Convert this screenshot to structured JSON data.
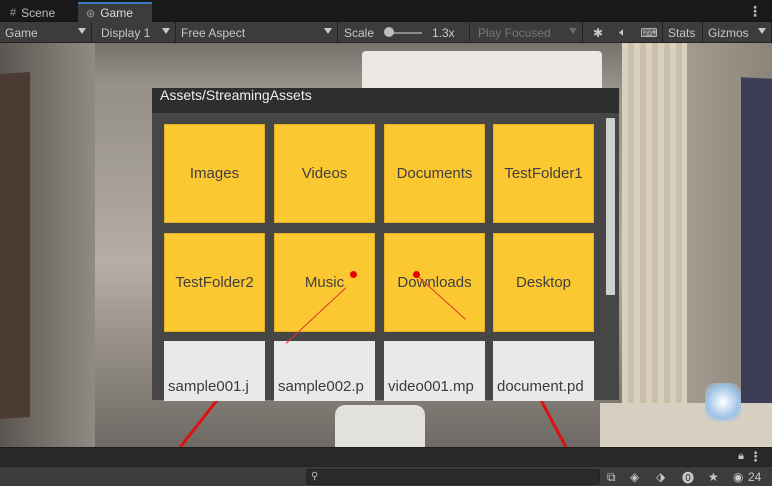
{
  "tabs": [
    {
      "label": "Scene",
      "icon": "grid-icon"
    },
    {
      "label": "Game",
      "icon": "gamepad-icon"
    }
  ],
  "toolbar": {
    "display_mode": "Game",
    "display": "Display 1",
    "aspect": "Free Aspect",
    "scale_label": "Scale",
    "scale_value": "1.3x",
    "play_mode": "Play Focused",
    "stats": "Stats",
    "gizmos": "Gizmos"
  },
  "panel": {
    "title": "Assets/StreamingAssets",
    "folders": [
      "Images",
      "Videos",
      "Documents",
      "TestFolder1",
      "TestFolder2",
      "Music",
      "Downloads",
      "Desktop"
    ],
    "files": [
      "sample001.j",
      "sample002.p",
      "video001.mp",
      "document.pd"
    ]
  },
  "statusbar": {
    "search_placeholder": "",
    "visibility_count": "24"
  }
}
